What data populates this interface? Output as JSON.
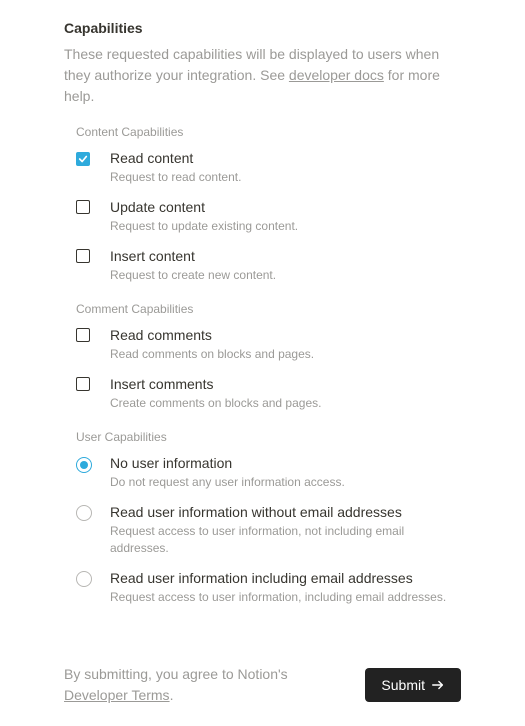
{
  "header": {
    "title": "Capabilities",
    "desc_pre": "These requested capabilities will be displayed to users when they authorize your integration. See ",
    "desc_link": "developer docs",
    "desc_post": " for more help."
  },
  "groups": {
    "content": {
      "title": "Content Capabilities",
      "items": [
        {
          "label": "Read content",
          "desc": "Request to read content.",
          "checked": true
        },
        {
          "label": "Update content",
          "desc": "Request to update existing content.",
          "checked": false
        },
        {
          "label": "Insert content",
          "desc": "Request to create new content.",
          "checked": false
        }
      ]
    },
    "comment": {
      "title": "Comment Capabilities",
      "items": [
        {
          "label": "Read comments",
          "desc": "Read comments on blocks and pages.",
          "checked": false
        },
        {
          "label": "Insert comments",
          "desc": "Create comments on blocks and pages.",
          "checked": false
        }
      ]
    },
    "user": {
      "title": "User Capabilities",
      "items": [
        {
          "label": "No user information",
          "desc": "Do not request any user information access.",
          "checked": true
        },
        {
          "label": "Read user information without email addresses",
          "desc": "Request access to user information, not including email addresses.",
          "checked": false
        },
        {
          "label": "Read user information including email addresses",
          "desc": "Request access to user information, including email addresses.",
          "checked": false
        }
      ]
    }
  },
  "footer": {
    "terms_pre": "By submitting, you agree to Notion's ",
    "terms_link": "Developer Terms",
    "terms_post": ".",
    "submit_label": "Submit"
  }
}
